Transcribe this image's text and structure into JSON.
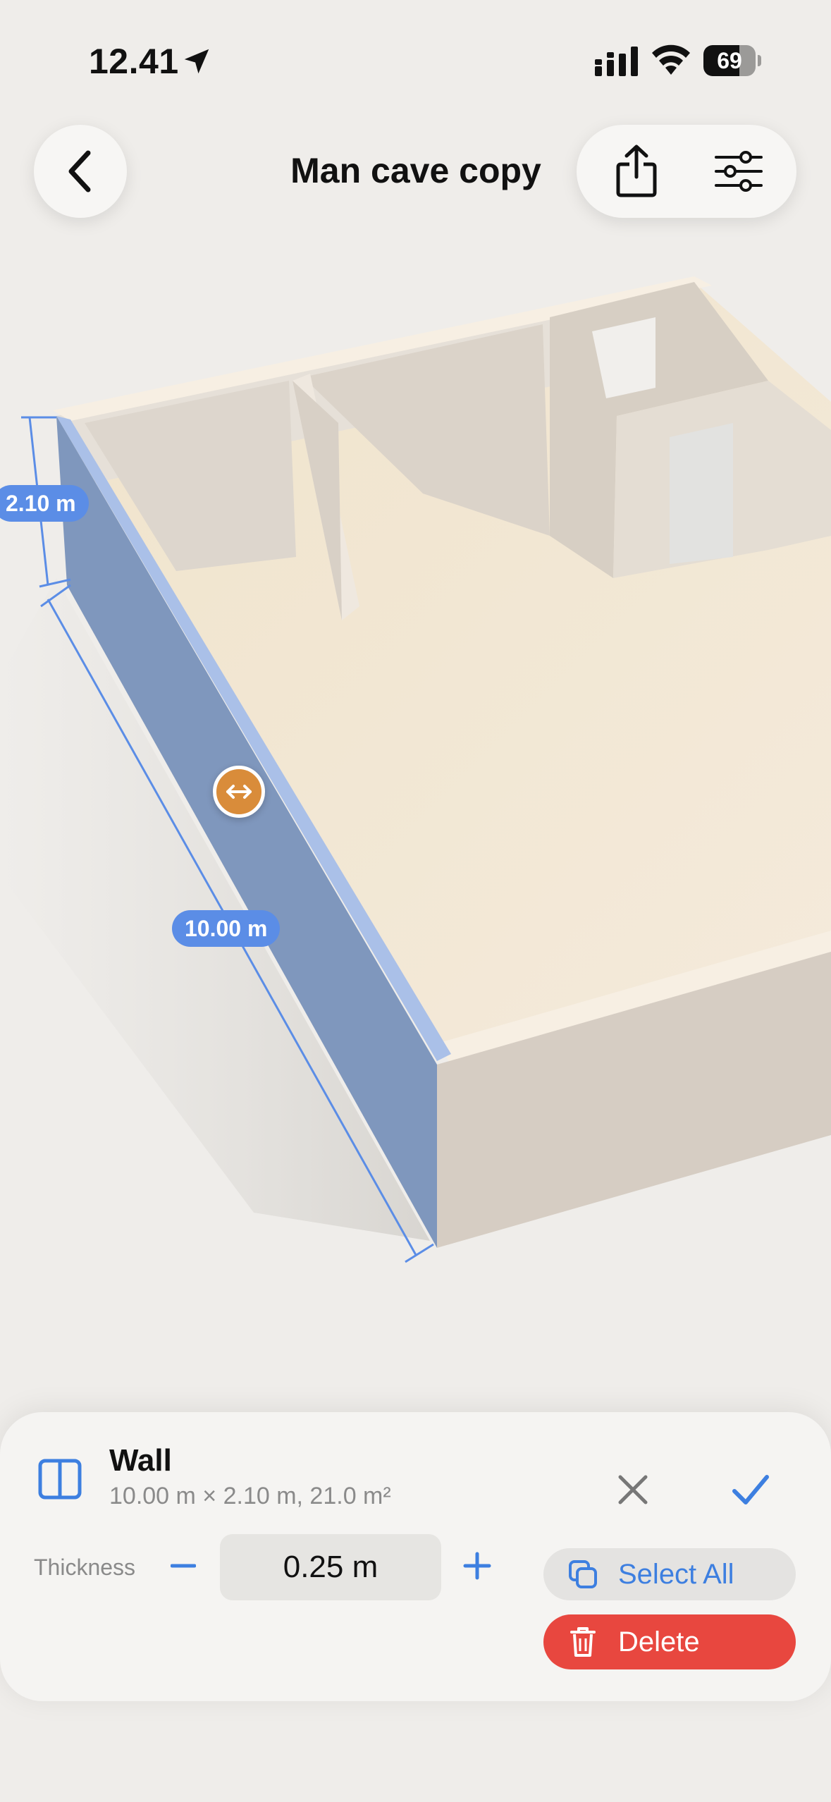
{
  "status_bar": {
    "time": "12.41",
    "battery": "69",
    "battery_level": 0.69
  },
  "header": {
    "title": "Man cave copy"
  },
  "scene": {
    "height_label": "2.10 m",
    "length_label": "10.00 m",
    "highlight_color": "#7f97bd",
    "accent_color": "#5b8de6",
    "handle_color": "#d98c3a"
  },
  "sheet": {
    "element_title": "Wall",
    "element_details": "10.00 m × 2.10 m, 21.0 m²",
    "thickness_label": "Thickness",
    "thickness_value": "0.25 m",
    "select_all_label": "Select All",
    "delete_label": "Delete"
  },
  "icons": {
    "back": "chevron-left-icon",
    "share": "share-icon",
    "settings": "sliders-icon",
    "wall": "wall-icon",
    "close": "close-icon",
    "confirm": "checkmark-icon",
    "copy": "copy-icon",
    "delete": "trash-icon"
  }
}
